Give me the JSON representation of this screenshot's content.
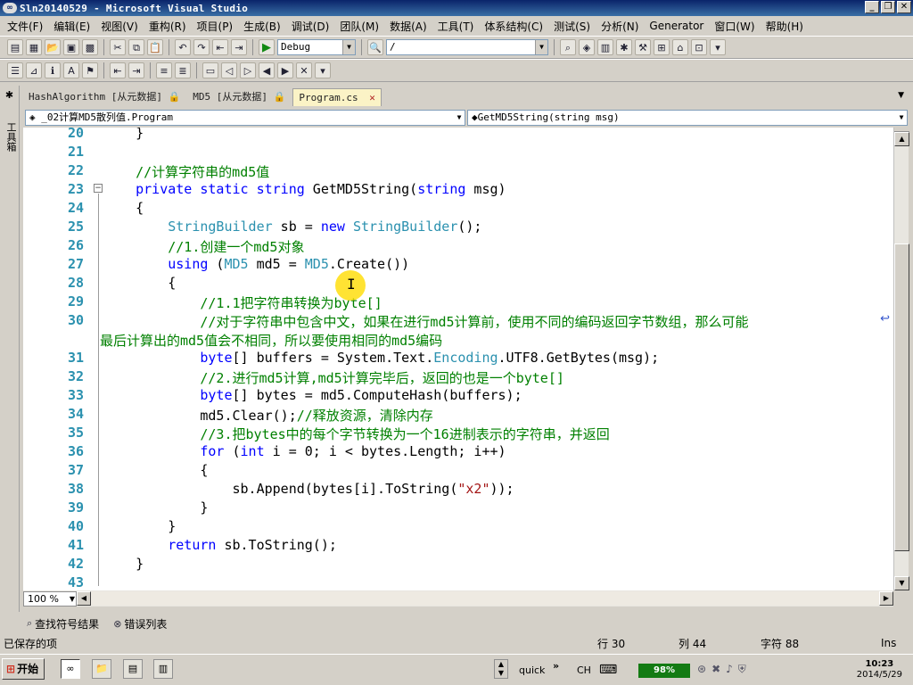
{
  "window": {
    "title": "Sln20140529 - Microsoft Visual Studio",
    "min_glyph": "_",
    "restore_glyph": "❐",
    "close_glyph": "✕"
  },
  "menu": [
    "文件(F)",
    "编辑(E)",
    "视图(V)",
    "重构(R)",
    "项目(P)",
    "生成(B)",
    "调试(D)",
    "团队(M)",
    "数据(A)",
    "工具(T)",
    "体系结构(C)",
    "测试(S)",
    "分析(N)",
    "Generator",
    "窗口(W)",
    "帮助(H)"
  ],
  "toolbar": {
    "config_value": "Debug",
    "find_value": "/"
  },
  "toolbox": {
    "label": "工具箱"
  },
  "tabs": [
    {
      "label": "HashAlgorithm [从元数据]",
      "pin": "🔒"
    },
    {
      "label": "MD5 [从元数据]",
      "pin": "🔒"
    },
    {
      "label": "Program.cs",
      "close": "✕"
    }
  ],
  "navbar": {
    "class": "_02计算MD5散列值.Program",
    "member": "GetMD5String(string msg)"
  },
  "code_lines": [
    {
      "n": "20",
      "t": "    }"
    },
    {
      "n": "21",
      "t": ""
    },
    {
      "n": "22",
      "t": "    //计算字符串的md5值"
    },
    {
      "n": "23",
      "t": "    private static string GetMD5String(string msg)"
    },
    {
      "n": "24",
      "t": "    {"
    },
    {
      "n": "25",
      "t": "        StringBuilder sb = new StringBuilder();"
    },
    {
      "n": "26",
      "t": "        //1.创建一个md5对象"
    },
    {
      "n": "27",
      "t": "        using (MD5 md5 = MD5.Create())"
    },
    {
      "n": "28",
      "t": "        {"
    },
    {
      "n": "29",
      "t": "            //1.1把字符串转换为byte[]"
    },
    {
      "n": "30",
      "t": "            //对于字符串中包含中文，如果在进行md5计算前，使用不同的编码返回字节数组，那么可能"
    },
    {
      "n": "",
      "t": "最后计算出的md5值会不相同，所以要使用相同的md5编码"
    },
    {
      "n": "31",
      "t": "            byte[] buffers = System.Text.Encoding.UTF8.GetBytes(msg);"
    },
    {
      "n": "32",
      "t": "            //2.进行md5计算,md5计算完毕后，返回的也是一个byte[]"
    },
    {
      "n": "33",
      "t": "            byte[] bytes = md5.ComputeHash(buffers);"
    },
    {
      "n": "34",
      "t": "            md5.Clear();//释放资源，清除内存"
    },
    {
      "n": "35",
      "t": "            //3.把bytes中的每个字节转换为一个16进制表示的字符串，并返回"
    },
    {
      "n": "36",
      "t": "            for (int i = 0; i < bytes.Length; i++)"
    },
    {
      "n": "37",
      "t": "            {"
    },
    {
      "n": "38",
      "t": "                sb.Append(bytes[i].ToString(\"x2\"));"
    },
    {
      "n": "39",
      "t": "            }"
    },
    {
      "n": "40",
      "t": "        }"
    },
    {
      "n": "41",
      "t": "        return sb.ToString();"
    },
    {
      "n": "42",
      "t": "    }"
    },
    {
      "n": "43",
      "t": ""
    }
  ],
  "zoom": "100 %",
  "bottom_tabs": [
    "查找符号结果",
    "错误列表"
  ],
  "status": {
    "left": "已保存的项",
    "line": "行 30",
    "col": "列 44",
    "ch": "字符 88",
    "mode": "Ins"
  },
  "taskbar": {
    "start": "开始",
    "quick": "quick",
    "lang": "CH",
    "battery": "98%",
    "time": "10:23",
    "date": "2014/5/29"
  },
  "colors": {
    "keyword": "#0000ff",
    "type": "#2b91af",
    "comment": "#008000",
    "string": "#a31515",
    "line_number": "#2b91af"
  }
}
